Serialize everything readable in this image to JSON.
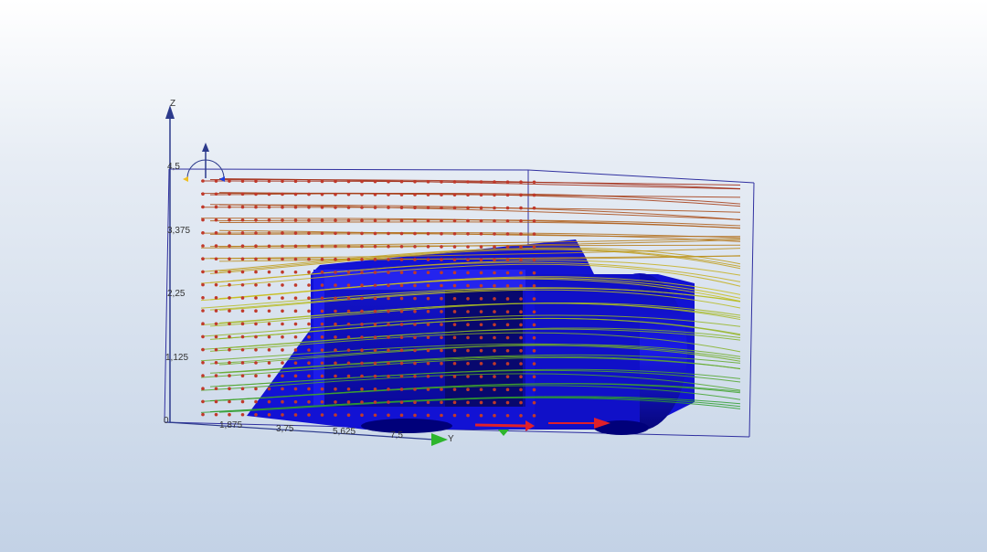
{
  "viewport": {
    "axes": {
      "z_label": "Z",
      "y_label": "Y",
      "z_ticks": [
        "4,5",
        "3,375",
        "2,25",
        "1,125",
        "0"
      ],
      "y_ticks": [
        "1,875",
        "3,75",
        "5,625",
        "7,5"
      ]
    },
    "colors": {
      "model": "#1010d8",
      "model_dark": "#00008a",
      "seed_points": "#c0392b",
      "streamline_low": "#2e9e2e",
      "streamline_mid": "#c8c020",
      "streamline_high": "#a02810",
      "bounding_box": "#3030a0",
      "axis_z": "#2c3a8c",
      "axis_y": "#2db52d",
      "axis_x": "#e0202a"
    }
  }
}
